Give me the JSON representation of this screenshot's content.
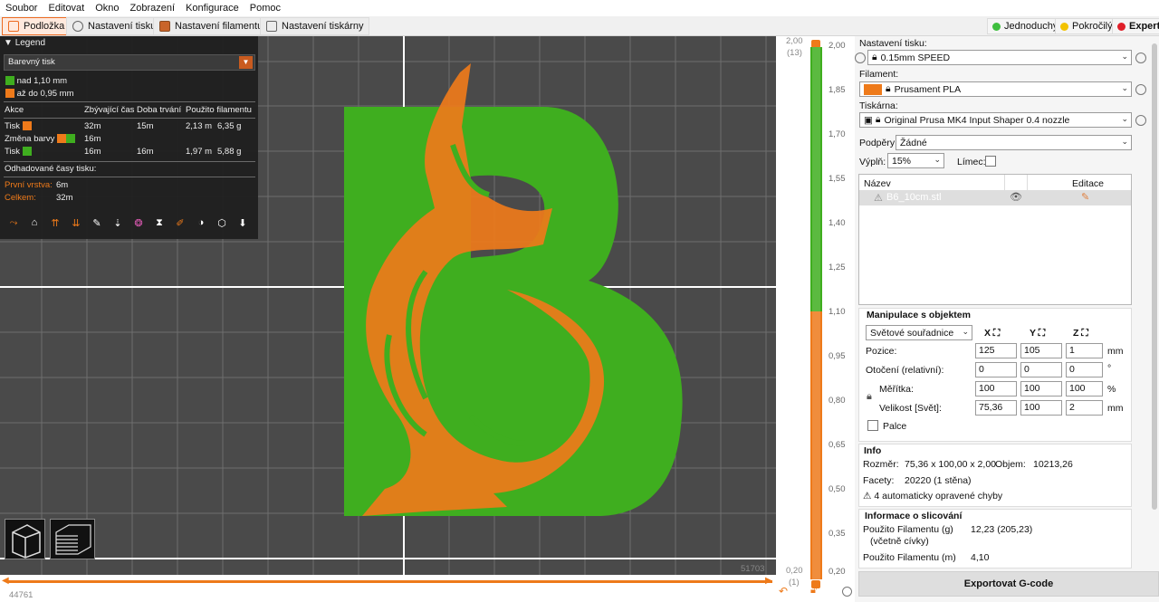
{
  "menu": [
    "Soubor",
    "Editovat",
    "Okno",
    "Zobrazení",
    "Konfigurace",
    "Pomoc"
  ],
  "tabs": [
    {
      "label": "Podložka",
      "active": true
    },
    {
      "label": "Nastavení tisku",
      "active": false
    },
    {
      "label": "Nastavení filamentu",
      "active": false
    },
    {
      "label": "Nastavení tiskárny",
      "active": false
    }
  ],
  "modes": [
    {
      "label": "Jednoduchý",
      "color": "#3fbf3f"
    },
    {
      "label": "Pokročilý",
      "color": "#f2c200"
    },
    {
      "label": "Expert",
      "color": "#e0202a"
    }
  ],
  "legend": {
    "title": "Legend",
    "view_type": "Barevný tisk",
    "ranges": [
      {
        "label": "nad 1,10 mm",
        "color": "#3fae1f"
      },
      {
        "label": "až do 0,95 mm",
        "color": "#ee7a1a"
      }
    ],
    "table_headers": [
      "Akce",
      "Zbývající čas",
      "Doba trvání",
      "Použito filamentu"
    ],
    "rows": [
      {
        "action": "Tisk",
        "remaining": "32m",
        "duration": "15m",
        "length": "2,13 m",
        "weight": "6,35 g"
      },
      {
        "action": "Změna barvy",
        "remaining": "16m",
        "duration": "",
        "length": "",
        "weight": ""
      },
      {
        "action": "Tisk",
        "remaining": "16m",
        "duration": "16m",
        "length": "1,97 m",
        "weight": "5,88 g"
      }
    ],
    "estimated_title": "Odhadované časy tisku:",
    "first_layer_label": "První vrstva:",
    "first_layer_value": "6m",
    "total_label": "Celkem:",
    "total_value": "32m"
  },
  "viewport": {
    "h_slider_left": "44761",
    "h_slider_right": "51703"
  },
  "vertical_slider": {
    "top_value": "2,00",
    "top_layer": "(13)",
    "bottom_value": "0,20",
    "bottom_layer": "(1)",
    "ticks": [
      "2,00",
      "1,85",
      "1,70",
      "1,55",
      "1,40",
      "1,25",
      "1,10",
      "0,95",
      "0,80",
      "0,65",
      "0,50",
      "0,35",
      "0,20"
    ],
    "upper_color": "#3fae1f",
    "lower_color": "#ee7a1a"
  },
  "sidebar": {
    "print_settings_label": "Nastavení tisku:",
    "print_settings_value": "0.15mm SPEED",
    "filament_label": "Filament:",
    "filament_value": "Prusament PLA",
    "filament_color": "#ee7a1a",
    "printer_label": "Tiskárna:",
    "printer_value": "Original Prusa MK4 Input Shaper 0.4 nozzle",
    "supports_label": "Podpěry:",
    "supports_value": "Žádné",
    "infill_label": "Výplň:",
    "infill_value": "15%",
    "brim_label": "Límec:",
    "object_list_headers": [
      "Název",
      "Editace"
    ],
    "object_name": "B6_10cm.stl",
    "manip_title": "Manipulace s objektem",
    "coord_system": "Světové souřadnice",
    "axes": [
      "X",
      "Y",
      "Z"
    ],
    "position_label": "Pozice:",
    "position": [
      "125",
      "105",
      "1"
    ],
    "position_unit": "mm",
    "rotation_label": "Otočení (relativní):",
    "rotation": [
      "0",
      "0",
      "0"
    ],
    "rotation_unit": "°",
    "scale_label": "Měřítka:",
    "scale": [
      "100",
      "100",
      "100"
    ],
    "scale_unit": "%",
    "size_label": "Velikost [Svět]:",
    "size": [
      "75,36",
      "100",
      "2"
    ],
    "size_unit": "mm",
    "inches_label": "Palce",
    "info_title": "Info",
    "size_info_label": "Rozměr:",
    "size_info_value": "75,36 x 100,00 x 2,00",
    "volume_label": "Objem:",
    "volume_value": "10213,26",
    "facets_label": "Facety:",
    "facets_value": "20220 (1 stěna)",
    "errors_text": "4 automaticky opravené chyby",
    "slice_info_title": "Informace o slicování",
    "filament_g_label": "Použito Filamentu (g)",
    "filament_g_sub": "(včetně cívky)",
    "filament_g_value": "12,23 (205,23)",
    "filament_m_label": "Použito Filamentu (m)",
    "filament_m_value": "4,10",
    "export_button": "Exportovat G-code"
  }
}
